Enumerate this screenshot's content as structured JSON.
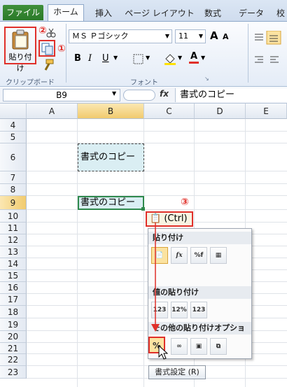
{
  "tabs": {
    "file": "ファイル",
    "home": "ホーム",
    "insert": "挿入",
    "page_layout": "ページ レイアウト",
    "formulas": "数式",
    "data": "データ",
    "more": "校"
  },
  "ribbon": {
    "paste_label": "貼り付け",
    "clipboard_group": "クリップボード",
    "font_group": "フォント",
    "font_name": "ＭＳ Ｐゴシック",
    "font_size": "11",
    "bold": "B",
    "italic": "I",
    "underline": "U",
    "grow_font": "A",
    "shrink_font": "A",
    "font_color_glyph": "A",
    "marker_1": "①",
    "marker_2": "②",
    "marker_3": "③"
  },
  "formula_bar": {
    "name_box": "B9",
    "fx": "fx",
    "value": "書式のコピー"
  },
  "columns": [
    "A",
    "B",
    "C",
    "D",
    "E"
  ],
  "rows": [
    "4",
    "5",
    "6",
    "7",
    "8",
    "9",
    "10",
    "11",
    "12",
    "13",
    "14",
    "15",
    "16",
    "17",
    "18",
    "19",
    "20",
    "21",
    "22",
    "23"
  ],
  "cells": {
    "b6": "書式のコピー",
    "b9": "書式のコピー"
  },
  "paste_options_button": "(Ctrl)",
  "paste_menu": {
    "section_paste": "貼り付け",
    "section_values": "値の貼り付け",
    "section_other": "その他の貼り付けオプション",
    "paste_icons": [
      "paste",
      "formulas",
      "formulas-number-format",
      "keep-source-formatting"
    ],
    "value_icons": [
      "values",
      "values-number-format",
      "values-source-formatting"
    ],
    "other_icons": [
      "formatting",
      "paste-link",
      "picture",
      "linked-picture"
    ]
  },
  "tooltip": "書式設定 (R)",
  "colors": {
    "accent_red": "#e0302a",
    "file_tab": "#2a7a28",
    "selection": "#2f8a4d"
  }
}
